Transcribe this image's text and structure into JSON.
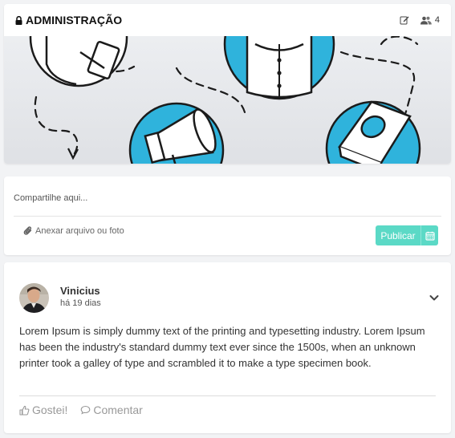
{
  "group": {
    "title": "ADMINISTRAÇÃO",
    "members_count": "4",
    "icons": {
      "lock": "lock-icon",
      "edit": "edit-icon",
      "members": "users-icon"
    }
  },
  "composer": {
    "placeholder": "Compartilhe aqui...",
    "attach_label": "Anexar arquivo ou foto",
    "publish_label": "Publicar",
    "icons": {
      "attach": "paperclip-icon",
      "schedule": "calendar-icon"
    }
  },
  "post": {
    "author": "Vinicius",
    "time": "há 19 dias",
    "text": "Lorem Ipsum is simply dummy text of the printing and typesetting industry. Lorem Ipsum has been the industry's standard dummy text ever since the 1500s, when an unknown printer took a galley of type and scrambled it to make a type specimen book.",
    "like_label": "Gostei!",
    "comment_label": "Comentar",
    "icons": {
      "menu": "chevron-down-icon",
      "like": "thumbs-up-icon",
      "comment": "comment-icon"
    }
  },
  "colors": {
    "accent": "#5bd9c6",
    "banner_blue": "#2fb3dc",
    "page_bg": "#f2f3f5"
  }
}
